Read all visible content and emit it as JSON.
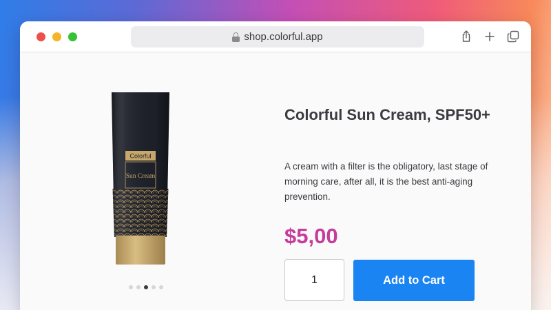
{
  "browser": {
    "url": "shop.colorful.app",
    "icons": [
      "lock-icon",
      "share-icon",
      "plus-icon",
      "tabs-icon"
    ]
  },
  "product": {
    "image_brand_text": "Colorful",
    "image_name_text": "Sun Cream",
    "title": "Colorful Sun Cream, SPF50+",
    "description": "A cream with a filter is the obligatory, last stage of morning care, after all, it is the best anti-aging prevention.",
    "price": "$5,00",
    "quantity": "1",
    "add_to_cart_label": "Add to Cart",
    "carousel": {
      "count": 5,
      "active_index": 2
    }
  },
  "colors": {
    "price": "#c63c9a",
    "button": "#1a84f2",
    "tube_dark": "#1d2029",
    "tube_gold": "#c7a86a"
  }
}
